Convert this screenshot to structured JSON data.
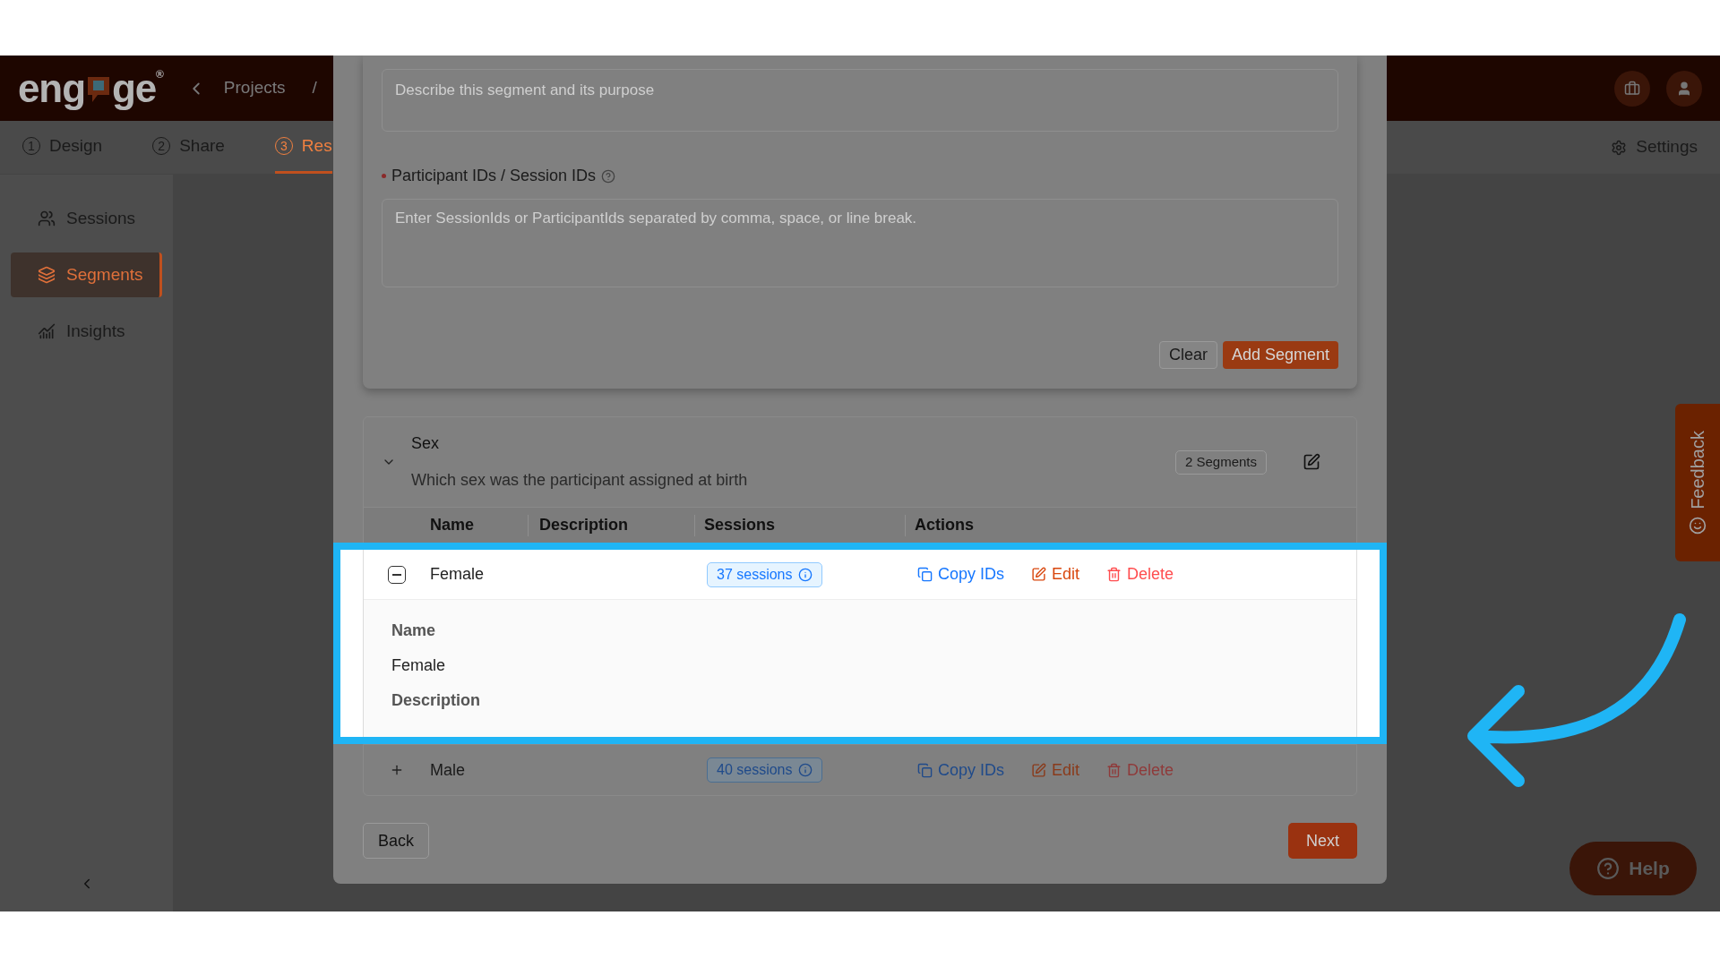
{
  "header": {
    "logo": {
      "parts": [
        "eng",
        "ge"
      ],
      "mark": "®"
    },
    "breadcrumb": [
      "Projects",
      "/"
    ]
  },
  "steps": [
    {
      "number": "1",
      "label": "Design",
      "selected": false
    },
    {
      "number": "2",
      "label": "Share",
      "selected": false
    },
    {
      "number": "3",
      "label": "Res",
      "selected": true
    }
  ],
  "settings": "Settings",
  "sidebar": {
    "items": [
      {
        "label": "Sessions",
        "selected": false
      },
      {
        "label": "Segments",
        "selected": true
      },
      {
        "label": "Insights",
        "selected": false
      }
    ]
  },
  "form": {
    "description_placeholder": "Describe this segment and its purpose",
    "ids_label": "Participant IDs / Session IDs",
    "required": true,
    "ids_placeholder": "Enter SessionIds or ParticipantIds separated by comma, space, or line break.",
    "buttons": [
      {
        "label": "Clear",
        "kind": "default"
      },
      {
        "label": "Add Segment",
        "kind": "primary"
      }
    ]
  },
  "group": {
    "title": "Sex",
    "question": "Which sex was the participant assigned at birth",
    "badge": "2 Segments",
    "expanded": true,
    "columns": [
      "Name",
      "Description",
      "Sessions",
      "Actions"
    ],
    "rows": [
      {
        "name": "Female",
        "expanded": true,
        "highlighted": true,
        "sessions": "37 sessions",
        "actions": [
          {
            "label": "Copy IDs",
            "kind": "copy"
          },
          {
            "label": "Edit",
            "kind": "edit"
          },
          {
            "label": "Delete",
            "kind": "delete"
          }
        ],
        "details": [
          {
            "kind": "label",
            "text": "Name"
          },
          {
            "kind": "value",
            "text": "Female"
          },
          {
            "kind": "label",
            "text": "Description"
          }
        ]
      },
      {
        "name": "Male",
        "expanded": false,
        "highlighted": false,
        "sessions": "40 sessions",
        "actions": [
          {
            "label": "Copy IDs",
            "kind": "copy"
          },
          {
            "label": "Edit",
            "kind": "edit"
          },
          {
            "label": "Delete",
            "kind": "delete"
          }
        ]
      }
    ]
  },
  "footer": {
    "back": "Back",
    "next": "Next"
  },
  "feedback": "Feedback",
  "help": "Help"
}
